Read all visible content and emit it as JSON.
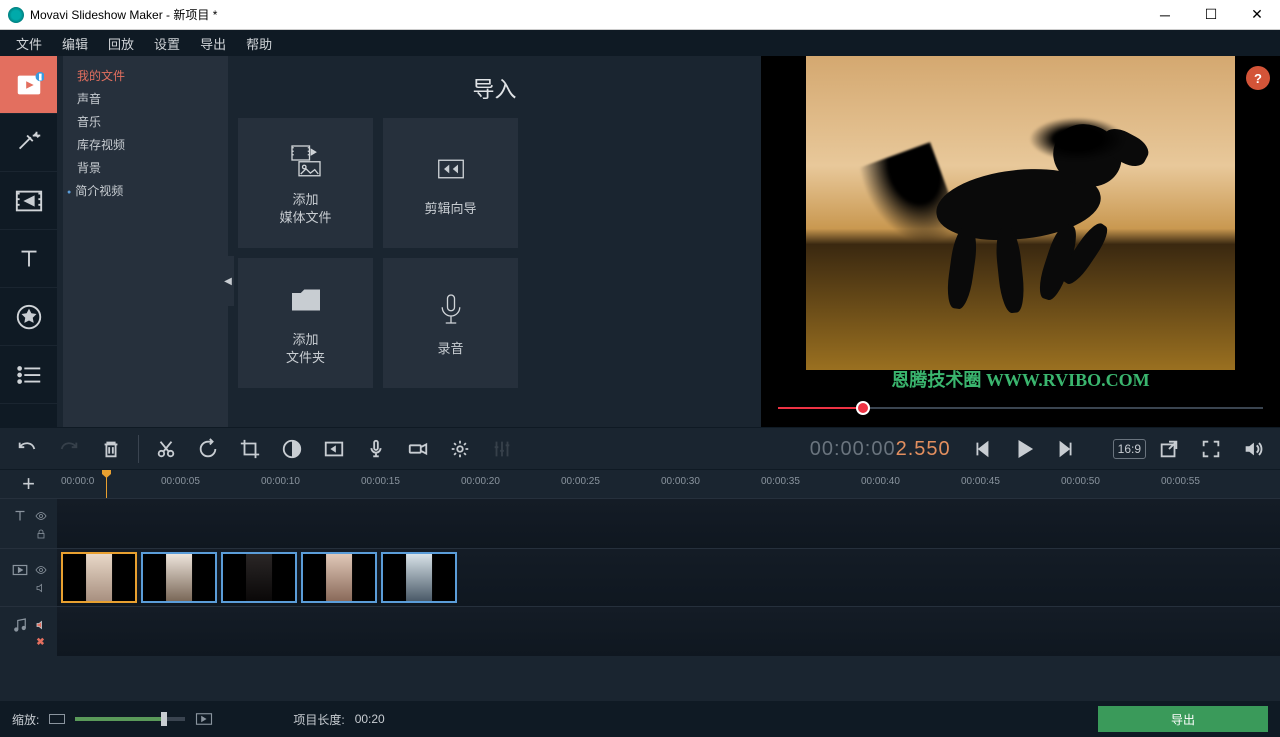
{
  "window": {
    "title": "Movavi Slideshow Maker - 新项目 *"
  },
  "menu": [
    "文件",
    "编辑",
    "回放",
    "设置",
    "导出",
    "帮助"
  ],
  "panel": {
    "title": "导入"
  },
  "sources": {
    "items": [
      "我的文件",
      "声音",
      "音乐",
      "库存视频",
      "背景",
      "简介视频"
    ],
    "active": 0,
    "dotted": [
      5
    ]
  },
  "cards": {
    "add_media": "添加\n媒体文件",
    "wizard": "剪辑向导",
    "add_folder": "添加\n文件夹",
    "record": "录音"
  },
  "watermark": "恩腾技术圈 WWW.RVIBO.COM",
  "help": "?",
  "timecode": {
    "gray_part": "00:00:0",
    "gray2": "0",
    "orange": "2.550"
  },
  "aspect": "16:9",
  "ruler": {
    "start_label": "00:00:0",
    "ticks": [
      "00:00:05",
      "00:00:10",
      "00:00:15",
      "00:00:20",
      "00:00:25",
      "00:00:30",
      "00:00:35",
      "00:00:40",
      "00:00:45",
      "00:00:50",
      "00:00:55"
    ]
  },
  "clips": {
    "count": 5,
    "selected": 0
  },
  "bottom": {
    "zoom_label": "缩放:",
    "duration_label": "项目长度:",
    "duration_value": "00:20",
    "export": "导出"
  }
}
